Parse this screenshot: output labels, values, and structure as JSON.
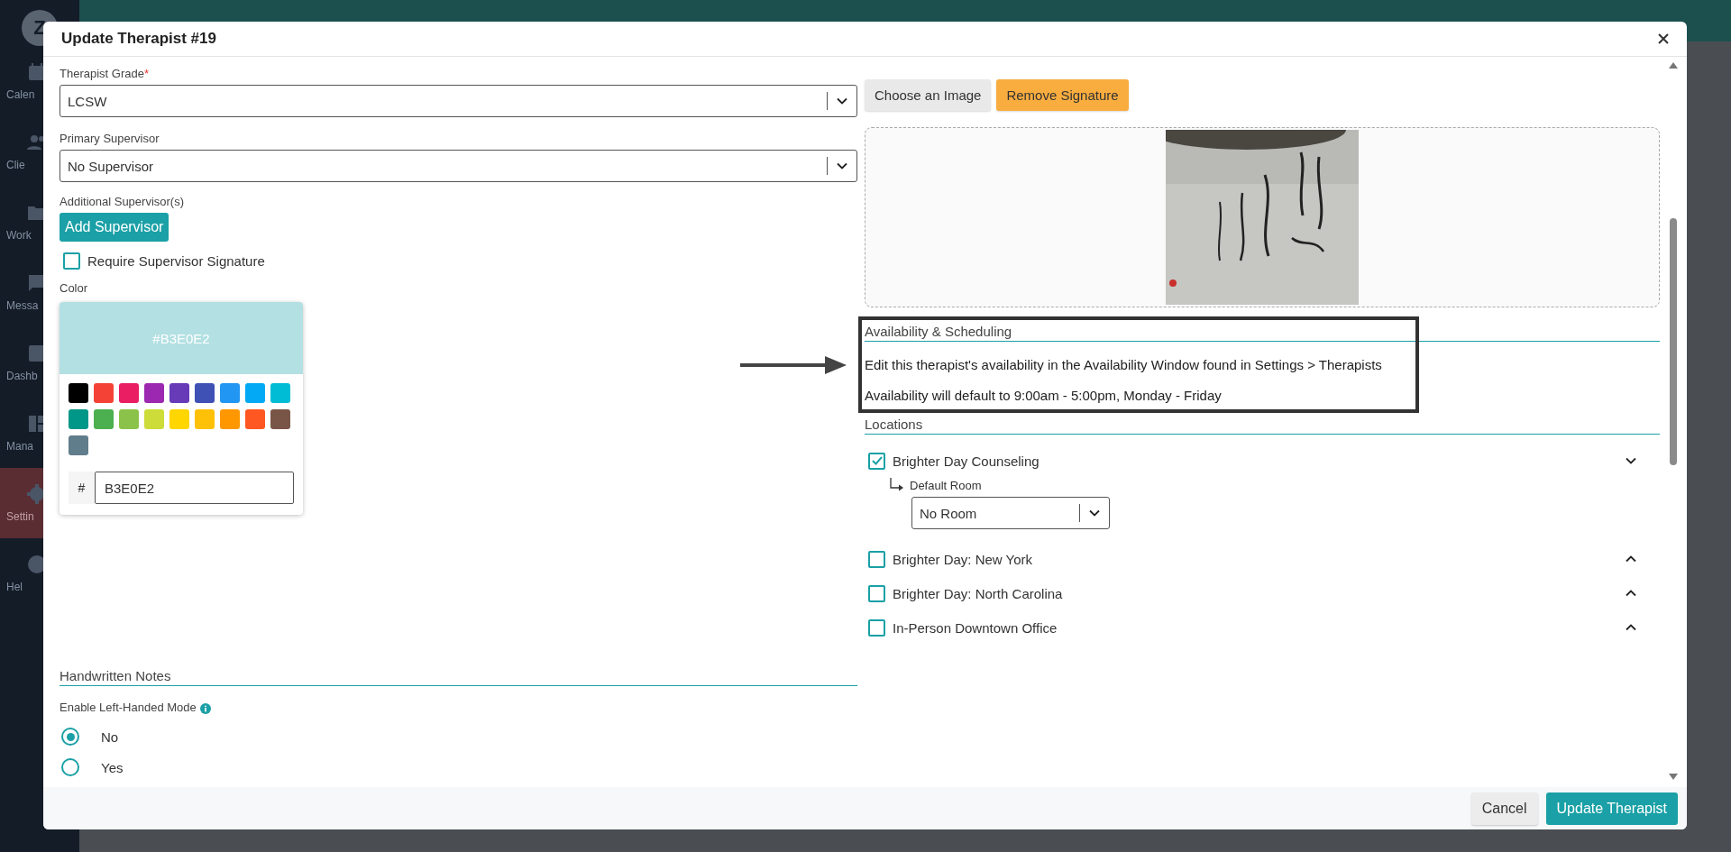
{
  "app": {
    "avatar": "Z",
    "sidebar": [
      {
        "label": "Calen",
        "selected": false
      },
      {
        "label": "Clie",
        "selected": false
      },
      {
        "label": "Work",
        "selected": false
      },
      {
        "label": "Messa",
        "selected": false
      },
      {
        "label": "Dashb",
        "selected": false
      },
      {
        "label": "Mana",
        "selected": false
      },
      {
        "label": "Settin",
        "selected": true
      },
      {
        "label": "Hel",
        "selected": false
      }
    ]
  },
  "modal": {
    "title": "Update Therapist #19",
    "therapist_grade": {
      "label": "Therapist Grade",
      "required_mark": "*",
      "value": "LCSW"
    },
    "primary_supervisor": {
      "label": "Primary Supervisor",
      "value": "No Supervisor"
    },
    "additional_supervisors": {
      "label": "Additional Supervisor(s)",
      "button": "Add Supervisor"
    },
    "require_signature": {
      "label": "Require Supervisor Signature",
      "checked": false
    },
    "color": {
      "label": "Color",
      "preview": "#B3E0E2",
      "hex_prefix": "#",
      "hex_value": "B3E0E2",
      "swatches": [
        {
          "color": "#000000"
        },
        {
          "color": "#f44336"
        },
        {
          "color": "#e91e63"
        },
        {
          "color": "#9c27b0"
        },
        {
          "color": "#673ab7"
        },
        {
          "color": "#3f51b5"
        },
        {
          "color": "#2196f3"
        },
        {
          "color": "#03a9f4"
        },
        {
          "color": "#00bcd4"
        },
        {
          "color": "#009688"
        },
        {
          "color": "#4caf50"
        },
        {
          "color": "#8bc34a"
        },
        {
          "color": "#cddc39"
        },
        {
          "color": "#ffd600"
        },
        {
          "color": "#ffc107"
        },
        {
          "color": "#ff9800"
        },
        {
          "color": "#ff5722"
        },
        {
          "color": "#795548"
        },
        {
          "color": "#607d8b"
        }
      ]
    },
    "handwritten_notes": {
      "heading": "Handwritten Notes",
      "label": "Enable Left-Handed Mode",
      "options": [
        {
          "label": "No",
          "selected": true
        },
        {
          "label": "Yes",
          "selected": false
        }
      ]
    },
    "signature": {
      "buttons": [
        {
          "label": "Choose an Image",
          "kind": "plain"
        },
        {
          "label": "Remove Signature",
          "kind": "warning"
        }
      ]
    },
    "availability": {
      "heading": "Availability & Scheduling",
      "lines": [
        "Edit this therapist's availability in the Availability Window found in Settings > Therapists",
        "Availability will default to 9:00am - 5:00pm, Monday - Friday"
      ]
    },
    "locations": {
      "heading": "Locations",
      "items": [
        {
          "name": "Brighter Day Counseling",
          "checked": true,
          "expanded": true,
          "room_label": "Default Room",
          "room_value": "No Room"
        },
        {
          "name": "Brighter Day: New York",
          "checked": false,
          "expanded": false
        },
        {
          "name": "Brighter Day: North Carolina",
          "checked": false,
          "expanded": false
        },
        {
          "name": "In-Person Downtown Office",
          "checked": false,
          "expanded": false
        }
      ]
    },
    "footer": {
      "buttons": [
        {
          "label": "Cancel",
          "kind": "secondary"
        },
        {
          "label": "Update Therapist",
          "kind": "primary"
        }
      ]
    }
  }
}
